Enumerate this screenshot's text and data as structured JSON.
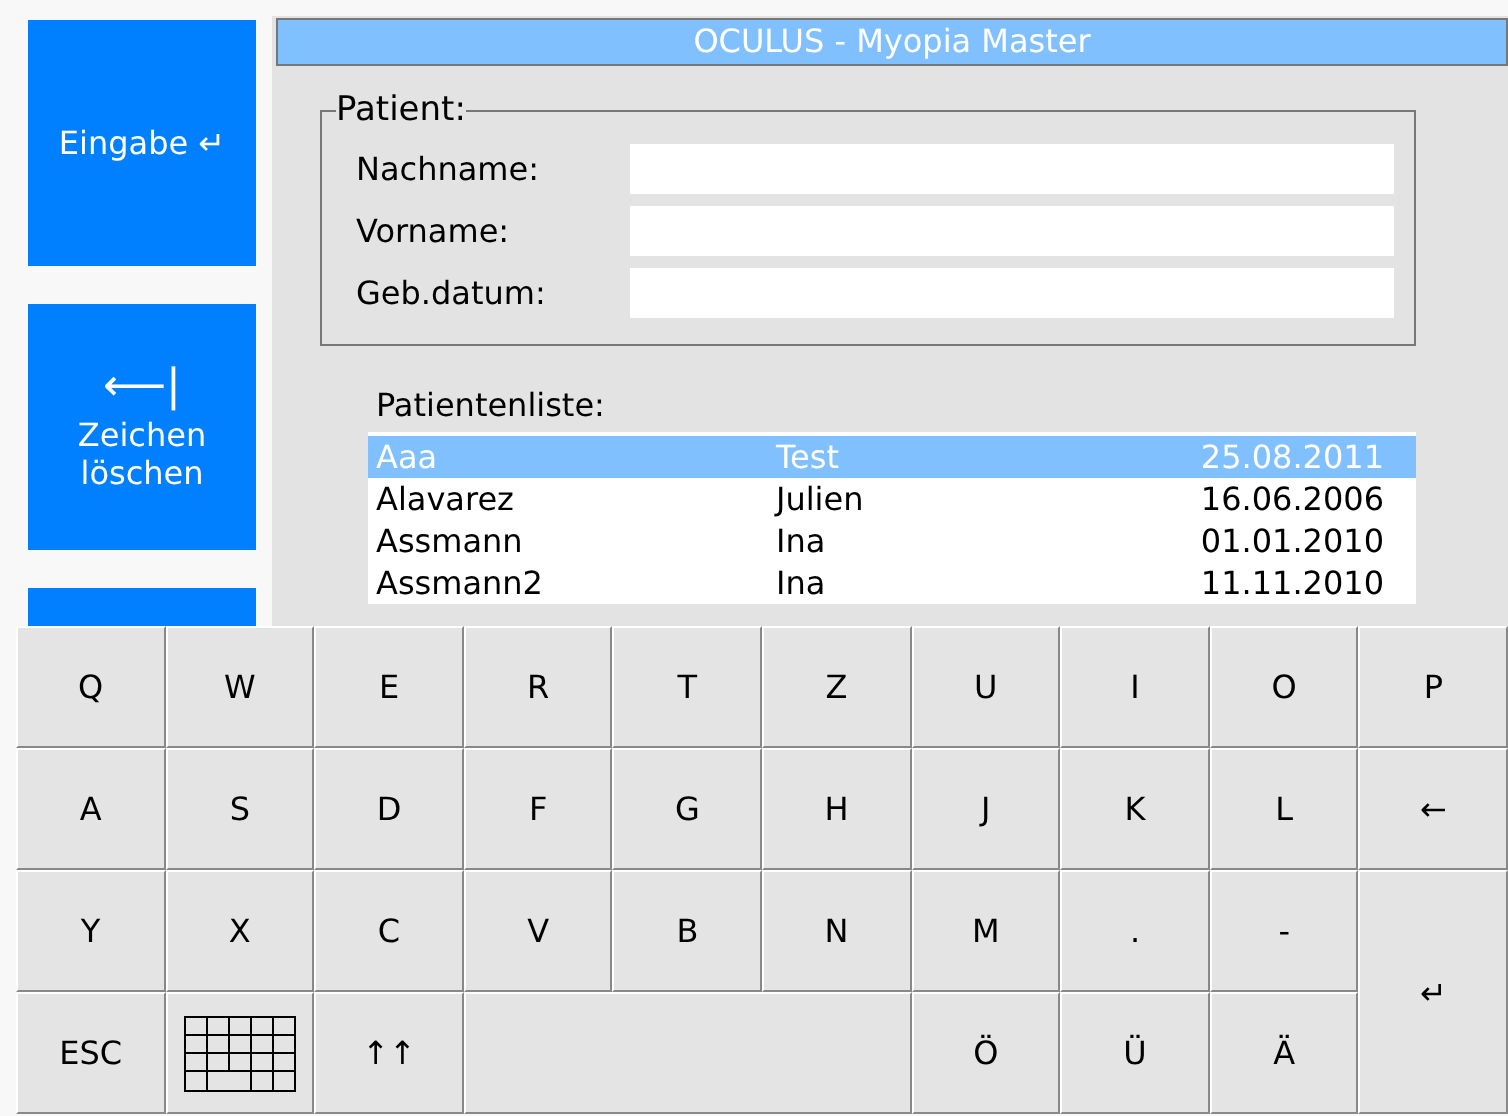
{
  "side_buttons": [
    {
      "kind": "enter",
      "label": "Eingabe",
      "icon": "↵"
    },
    {
      "kind": "delete",
      "label": "Zeichen löschen",
      "icon": "⟵|"
    },
    {
      "kind": "blank"
    }
  ],
  "window": {
    "title": "OCULUS - Myopia Master"
  },
  "patient": {
    "legend": "Patient:",
    "fields": [
      {
        "label": "Nachname:"
      },
      {
        "label": "Vorname:"
      },
      {
        "label": "Geb.datum:"
      }
    ]
  },
  "patient_list": {
    "title": "Patientenliste:",
    "rows": [
      {
        "last_name": "Aaa",
        "first_name": "Test",
        "birth_date": "25.08.2011",
        "selected": true
      },
      {
        "last_name": "Alavarez",
        "first_name": "Julien",
        "birth_date": "16.06.2006",
        "selected": false
      },
      {
        "last_name": "Assmann",
        "first_name": "Ina",
        "birth_date": "01.01.2010",
        "selected": false
      },
      {
        "last_name": "Assmann2",
        "first_name": "Ina",
        "birth_date": "11.11.2010",
        "selected": false
      }
    ]
  },
  "keyboard": [
    {
      "kind": "char",
      "label": "Q"
    },
    {
      "kind": "char",
      "label": "W"
    },
    {
      "kind": "char",
      "label": "E"
    },
    {
      "kind": "char",
      "label": "R"
    },
    {
      "kind": "char",
      "label": "T"
    },
    {
      "kind": "char",
      "label": "Z"
    },
    {
      "kind": "char",
      "label": "U"
    },
    {
      "kind": "char",
      "label": "I"
    },
    {
      "kind": "char",
      "label": "O"
    },
    {
      "kind": "char",
      "label": "P"
    },
    {
      "kind": "char",
      "label": "A"
    },
    {
      "kind": "char",
      "label": "S"
    },
    {
      "kind": "char",
      "label": "D"
    },
    {
      "kind": "char",
      "label": "F"
    },
    {
      "kind": "char",
      "label": "G"
    },
    {
      "kind": "char",
      "label": "H"
    },
    {
      "kind": "char",
      "label": "J"
    },
    {
      "kind": "char",
      "label": "K"
    },
    {
      "kind": "char",
      "label": "L"
    },
    {
      "kind": "backspace",
      "label": "←"
    },
    {
      "kind": "char",
      "label": "Y"
    },
    {
      "kind": "char",
      "label": "X"
    },
    {
      "kind": "char",
      "label": "C"
    },
    {
      "kind": "char",
      "label": "V"
    },
    {
      "kind": "char",
      "label": "B"
    },
    {
      "kind": "char",
      "label": "N"
    },
    {
      "kind": "char",
      "label": "M"
    },
    {
      "kind": "char",
      "label": "."
    },
    {
      "kind": "char",
      "label": "-"
    },
    {
      "kind": "enter",
      "label": "↵"
    },
    {
      "kind": "char",
      "label": "ESC"
    },
    {
      "kind": "grid"
    },
    {
      "kind": "shift",
      "label": "↑↑"
    },
    {
      "kind": "space"
    },
    {
      "kind": "char",
      "label": "Ö"
    },
    {
      "kind": "char",
      "label": "Ü"
    },
    {
      "kind": "char",
      "label": "Ä"
    }
  ]
}
